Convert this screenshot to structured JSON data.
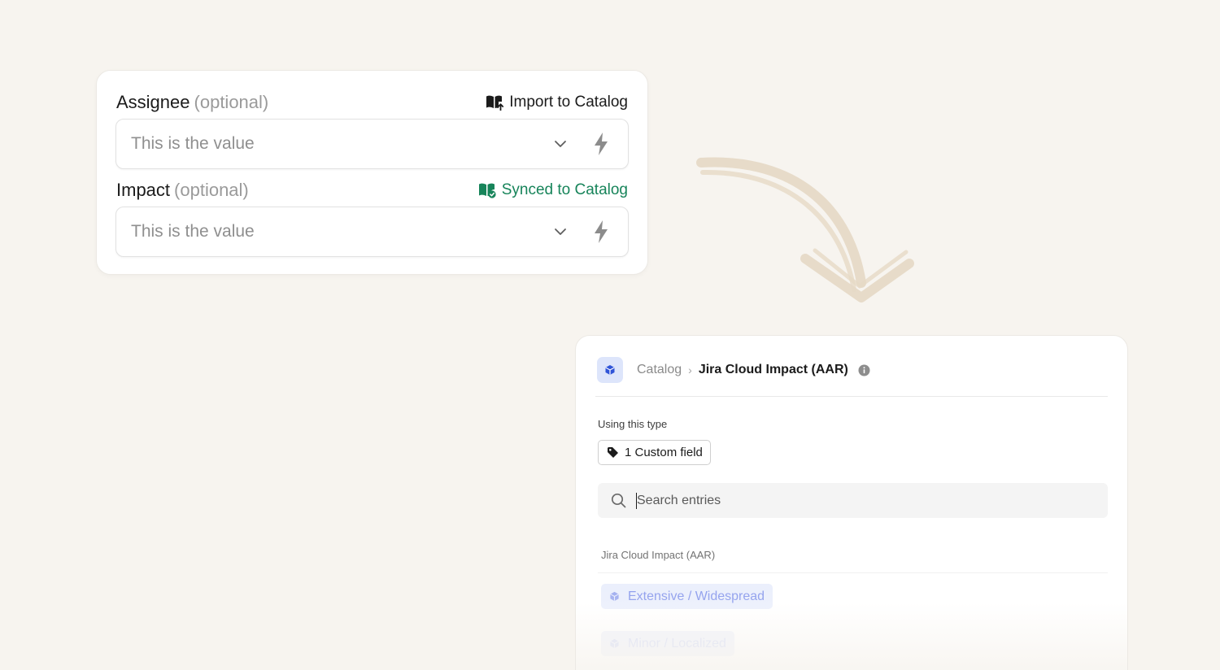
{
  "form": {
    "assignee": {
      "label": "Assignee",
      "optional": "(optional)",
      "action_label": "Import to Catalog",
      "value": "This is the value"
    },
    "impact": {
      "label": "Impact",
      "optional": "(optional)",
      "action_label": "Synced to Catalog",
      "value": "This is the value"
    }
  },
  "catalog": {
    "breadcrumb": {
      "root": "Catalog",
      "separator": "›",
      "current": "Jira Cloud Impact (AAR)"
    },
    "using_label": "Using this type",
    "custom_field_chip": "1 Custom field",
    "search": {
      "placeholder": "Search entries"
    },
    "section_label": "Jira Cloud Impact (AAR)",
    "entries": [
      {
        "label": "Extensive / Widespread"
      },
      {
        "label": "Minor / Localized"
      }
    ]
  },
  "colors": {
    "background": "#f7f4ef",
    "synced_green": "#17845a",
    "accent_blue": "#6379e6",
    "chip_blue_bg": "#e3e9fb",
    "arrow": "#e6d9c6"
  },
  "icons": {
    "import": "book-import-icon",
    "synced": "book-check-icon",
    "chevron": "chevron-down-icon",
    "bolt": "lightning-bolt-icon",
    "catalog": "cube-icon",
    "info": "info-icon",
    "tag": "tag-icon",
    "search": "search-icon"
  }
}
